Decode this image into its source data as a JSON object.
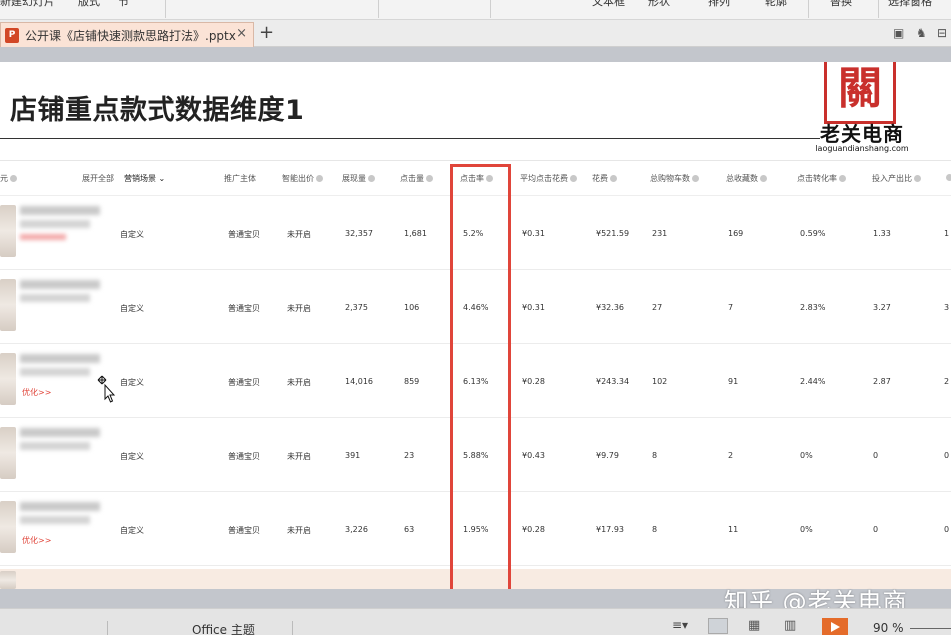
{
  "ribbon": {
    "items": [
      "新建幻灯片",
      "版式",
      "节",
      "文本框",
      "形状",
      "排列",
      "轮廓",
      "替换",
      "选择窗格"
    ]
  },
  "tab": {
    "title": "公开课《店铺快速测款思路打法》.pptx",
    "icon": "ppt-file-icon",
    "close": "×",
    "new": "+"
  },
  "slide": {
    "title": "店铺重点款式数据维度1",
    "logo": {
      "name": "老关电商",
      "url": "laoguandianshang.com"
    },
    "table": {
      "headers": [
        "元",
        "展开全部",
        "营销场景",
        "推广主体",
        "智能出价",
        "展现量",
        "点击量",
        "点击率",
        "平均点击花费",
        "花费",
        "总购物车数",
        "总收藏数",
        "点击转化率",
        "投入产出比"
      ],
      "rows": [
        [
          "自定义",
          "普通宝贝",
          "未开启",
          "32,357",
          "1,681",
          "5.2%",
          "¥0.31",
          "¥521.59",
          "231",
          "169",
          "0.59%",
          "1.33",
          "1"
        ],
        [
          "自定义",
          "普通宝贝",
          "未开启",
          "2,375",
          "106",
          "4.46%",
          "¥0.31",
          "¥32.36",
          "27",
          "7",
          "2.83%",
          "3.27",
          "3"
        ],
        [
          "自定义",
          "普通宝贝",
          "未开启",
          "14,016",
          "859",
          "6.13%",
          "¥0.28",
          "¥243.34",
          "102",
          "91",
          "2.44%",
          "2.87",
          "2"
        ],
        [
          "自定义",
          "普通宝贝",
          "未开启",
          "391",
          "23",
          "5.88%",
          "¥0.43",
          "¥9.79",
          "8",
          "2",
          "0%",
          "0",
          "0"
        ],
        [
          "自定义",
          "普通宝贝",
          "未开启",
          "3,226",
          "63",
          "1.95%",
          "¥0.28",
          "¥17.93",
          "8",
          "11",
          "0%",
          "0",
          "0"
        ]
      ],
      "row_links": [
        "",
        "",
        "优化>>",
        "",
        "优化>>"
      ]
    }
  },
  "status": {
    "theme": "Office 主题",
    "zoom": "90 %"
  },
  "watermark": "知乎 @老关电商",
  "colors": {
    "highlight": "#e0453a",
    "logo_red": "#c9302c",
    "tab_active": "#fbe3d6",
    "play": "#e46b2a"
  }
}
